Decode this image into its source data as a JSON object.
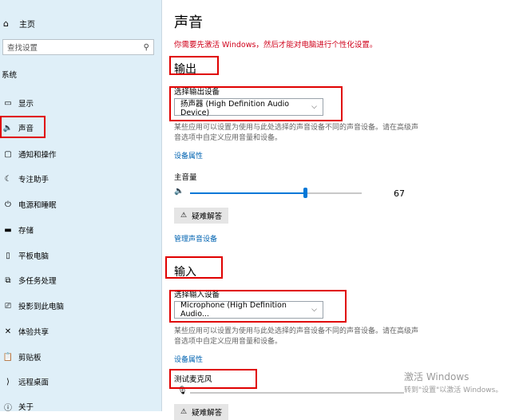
{
  "sidebar": {
    "home_label": "主页",
    "search_placeholder": "查找设置",
    "section_title": "系统",
    "items": [
      {
        "label": "显示",
        "icon": "display-icon"
      },
      {
        "label": "声音",
        "icon": "speaker-icon"
      },
      {
        "label": "通知和操作",
        "icon": "notification-icon"
      },
      {
        "label": "专注助手",
        "icon": "focus-moon-icon"
      },
      {
        "label": "电源和睡眠",
        "icon": "power-icon"
      },
      {
        "label": "存储",
        "icon": "storage-icon"
      },
      {
        "label": "平板电脑",
        "icon": "tablet-icon"
      },
      {
        "label": "多任务处理",
        "icon": "multitask-icon"
      },
      {
        "label": "投影到此电脑",
        "icon": "project-icon"
      },
      {
        "label": "体验共享",
        "icon": "share-icon"
      },
      {
        "label": "剪贴板",
        "icon": "clipboard-icon"
      },
      {
        "label": "远程桌面",
        "icon": "remote-desktop-icon"
      },
      {
        "label": "关于",
        "icon": "info-icon"
      }
    ]
  },
  "main": {
    "title": "声音",
    "warning": "你需要先激活 Windows，然后才能对电脑进行个性化设置。",
    "output": {
      "heading": "输出",
      "choose_label": "选择输出设备",
      "device": "扬声器 (High Definition Audio Device)",
      "description": "某些应用可以设置为使用与此处选择的声音设备不同的声音设备。请在高级声音选项中自定义应用音量和设备。",
      "device_properties": "设备属性",
      "master_volume_label": "主音量",
      "volume_value": "67",
      "volume": 67,
      "troubleshoot": "疑难解答",
      "manage_devices": "管理声音设备"
    },
    "input": {
      "heading": "输入",
      "choose_label": "选择输入设备",
      "device": "Microphone (High Definition Audio...",
      "description": "某些应用可以设置为使用与此处选择的声音设备不同的声音设备。请在高级声音选项中自定义应用音量和设备。",
      "device_properties": "设备属性",
      "test_mic_label": "测试麦克风",
      "troubleshoot": "疑难解答"
    }
  },
  "watermark": {
    "line1": "激活 Windows",
    "line2": "转到\"设置\"以激活 Windows。"
  },
  "colors": {
    "sidebar_bg": "#dfeff8",
    "accent": "#0078d7",
    "link": "#0063b1",
    "warning": "#d0021b",
    "highlight_box": "#e00000"
  }
}
